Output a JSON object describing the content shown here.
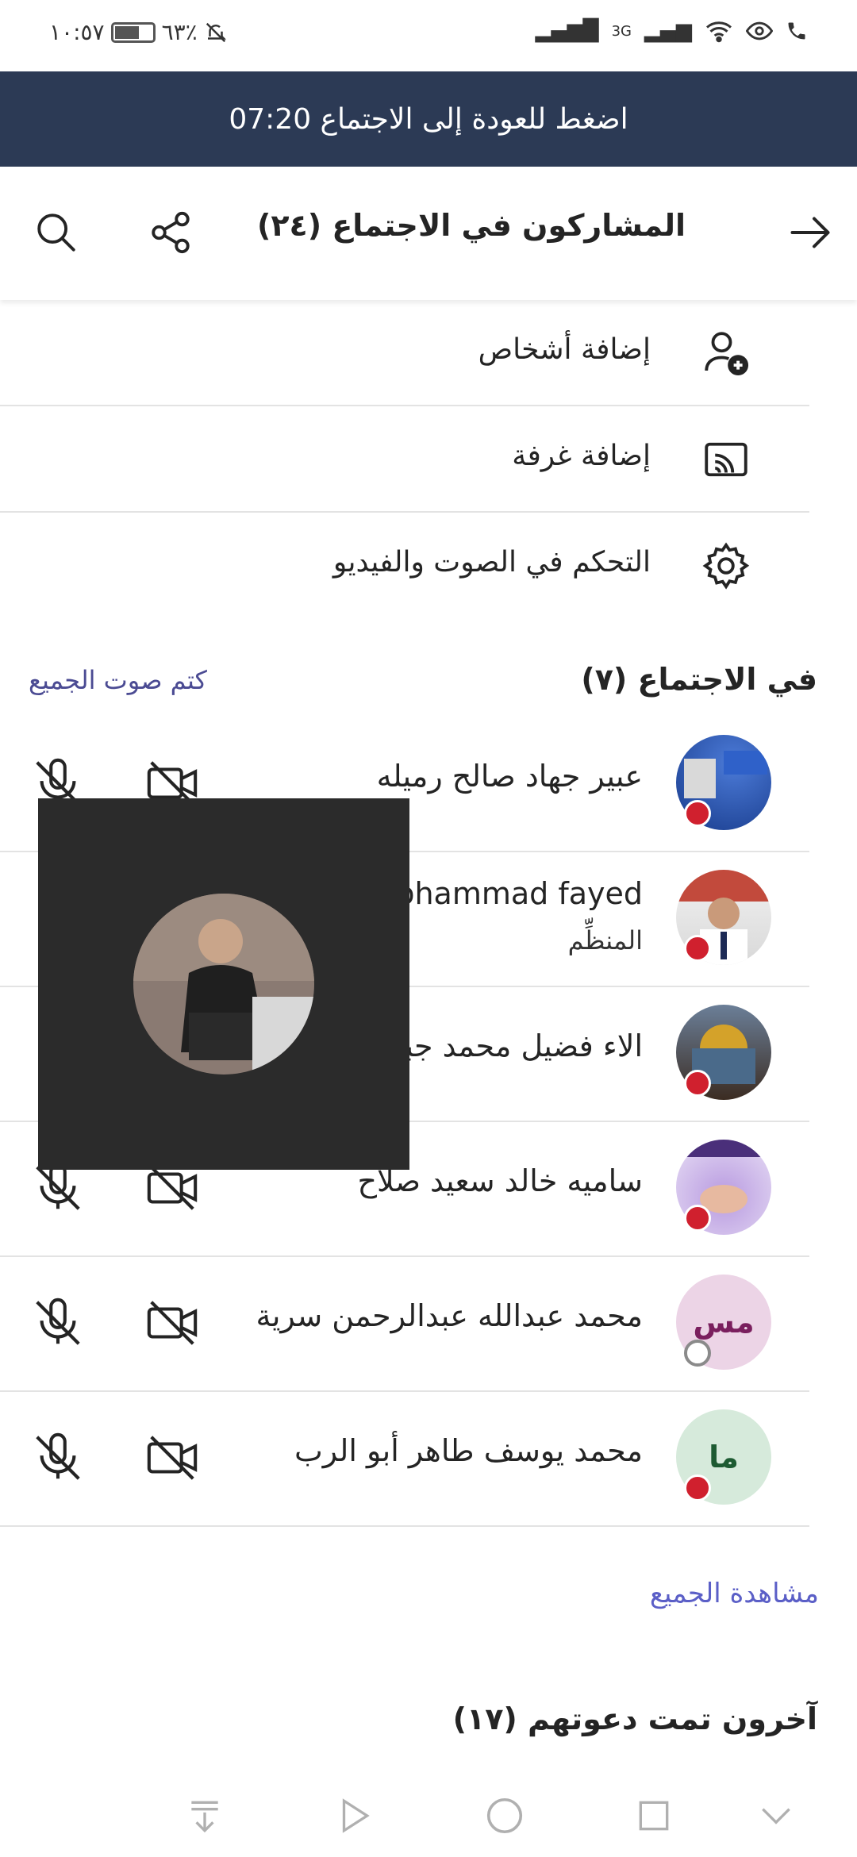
{
  "status_bar": {
    "time": "١٠:٥٧",
    "battery": "٦٣٪",
    "network": "3G"
  },
  "banner": {
    "text": "اضغط للعودة إلى الاجتماع 07:20"
  },
  "header": {
    "title": "المشاركون في الاجتماع (٢٤)",
    "back_icon": "arrow-right-icon",
    "share_icon": "share-icon",
    "search_icon": "search-icon"
  },
  "actions": [
    {
      "label": "إضافة أشخاص",
      "icon": "add-person-icon"
    },
    {
      "label": "إضافة غرفة",
      "icon": "cast-icon"
    },
    {
      "label": "التحكم في الصوت والفيديو",
      "icon": "gear-icon"
    }
  ],
  "in_meeting": {
    "title": "في الاجتماع (٧)",
    "mute_all": "كتم صوت الجميع"
  },
  "participants": [
    {
      "name": "عبير جهاد صالح رميله",
      "role": "",
      "initials": "",
      "status": "red"
    },
    {
      "name": "Mohammad fayed",
      "role": "المنظِّم",
      "initials": "",
      "status": "red"
    },
    {
      "name": "الاء فضيل محمد جبر",
      "role": "",
      "initials": "",
      "status": "red"
    },
    {
      "name": "ساميه خالد سعيد صلاح",
      "role": "",
      "initials": "",
      "status": "red"
    },
    {
      "name": "محمد عبدالله عبدالرحمن سرية",
      "role": "",
      "initials": "مس",
      "status": "offline"
    },
    {
      "name": "محمد يوسف طاهر أبو الرب",
      "role": "",
      "initials": "ما",
      "status": "red"
    }
  ],
  "see_all": "مشاهدة الجميع",
  "invited": {
    "title": "آخرون تمت دعوتهم (١٧)"
  },
  "colors": {
    "banner_bg": "#2c3a55",
    "accent": "#5b5fc7",
    "status_red": "#d0202e"
  }
}
